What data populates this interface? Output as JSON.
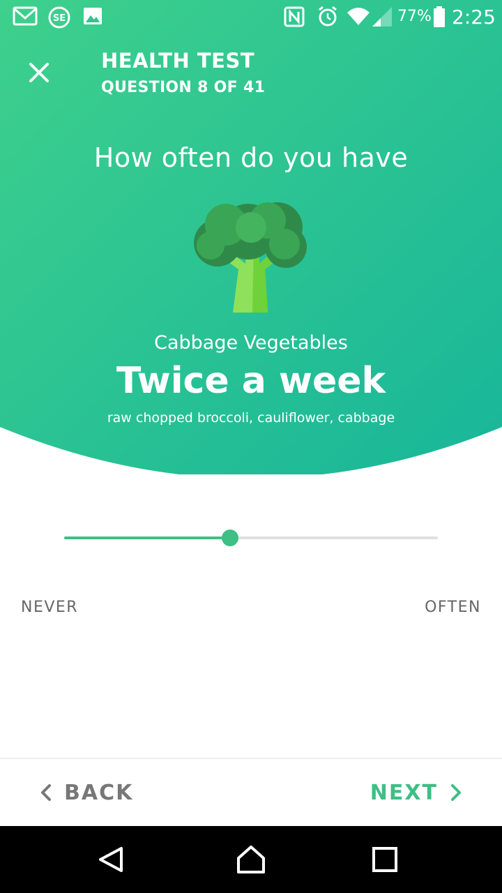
{
  "status_bar": {
    "icons": [
      "gmail-icon",
      "se-app-icon",
      "image-icon",
      "nfc-icon",
      "alarm-icon",
      "wifi-icon",
      "cell-signal-icon",
      "battery-icon"
    ],
    "battery": "77%",
    "time": "2:25"
  },
  "header": {
    "title": "HEALTH TEST",
    "subtitle": "QUESTION 8 OF 41"
  },
  "question": {
    "prompt": "How often do you have",
    "category": "Cabbage Vegetables",
    "answer": "Twice a week",
    "examples": "raw chopped broccoli, cauliflower, cabbage",
    "illustration": "broccoli-icon"
  },
  "slider": {
    "value_fraction": 0.444,
    "min_label": "NEVER",
    "max_label": "OFTEN"
  },
  "footer": {
    "back_label": "BACK",
    "next_label": "NEXT"
  },
  "colors": {
    "gradient_start": "#3ed08c",
    "gradient_end": "#1bb898",
    "accent": "#3dbf86",
    "track": "#e0e0e0",
    "muted_text": "#777777"
  }
}
